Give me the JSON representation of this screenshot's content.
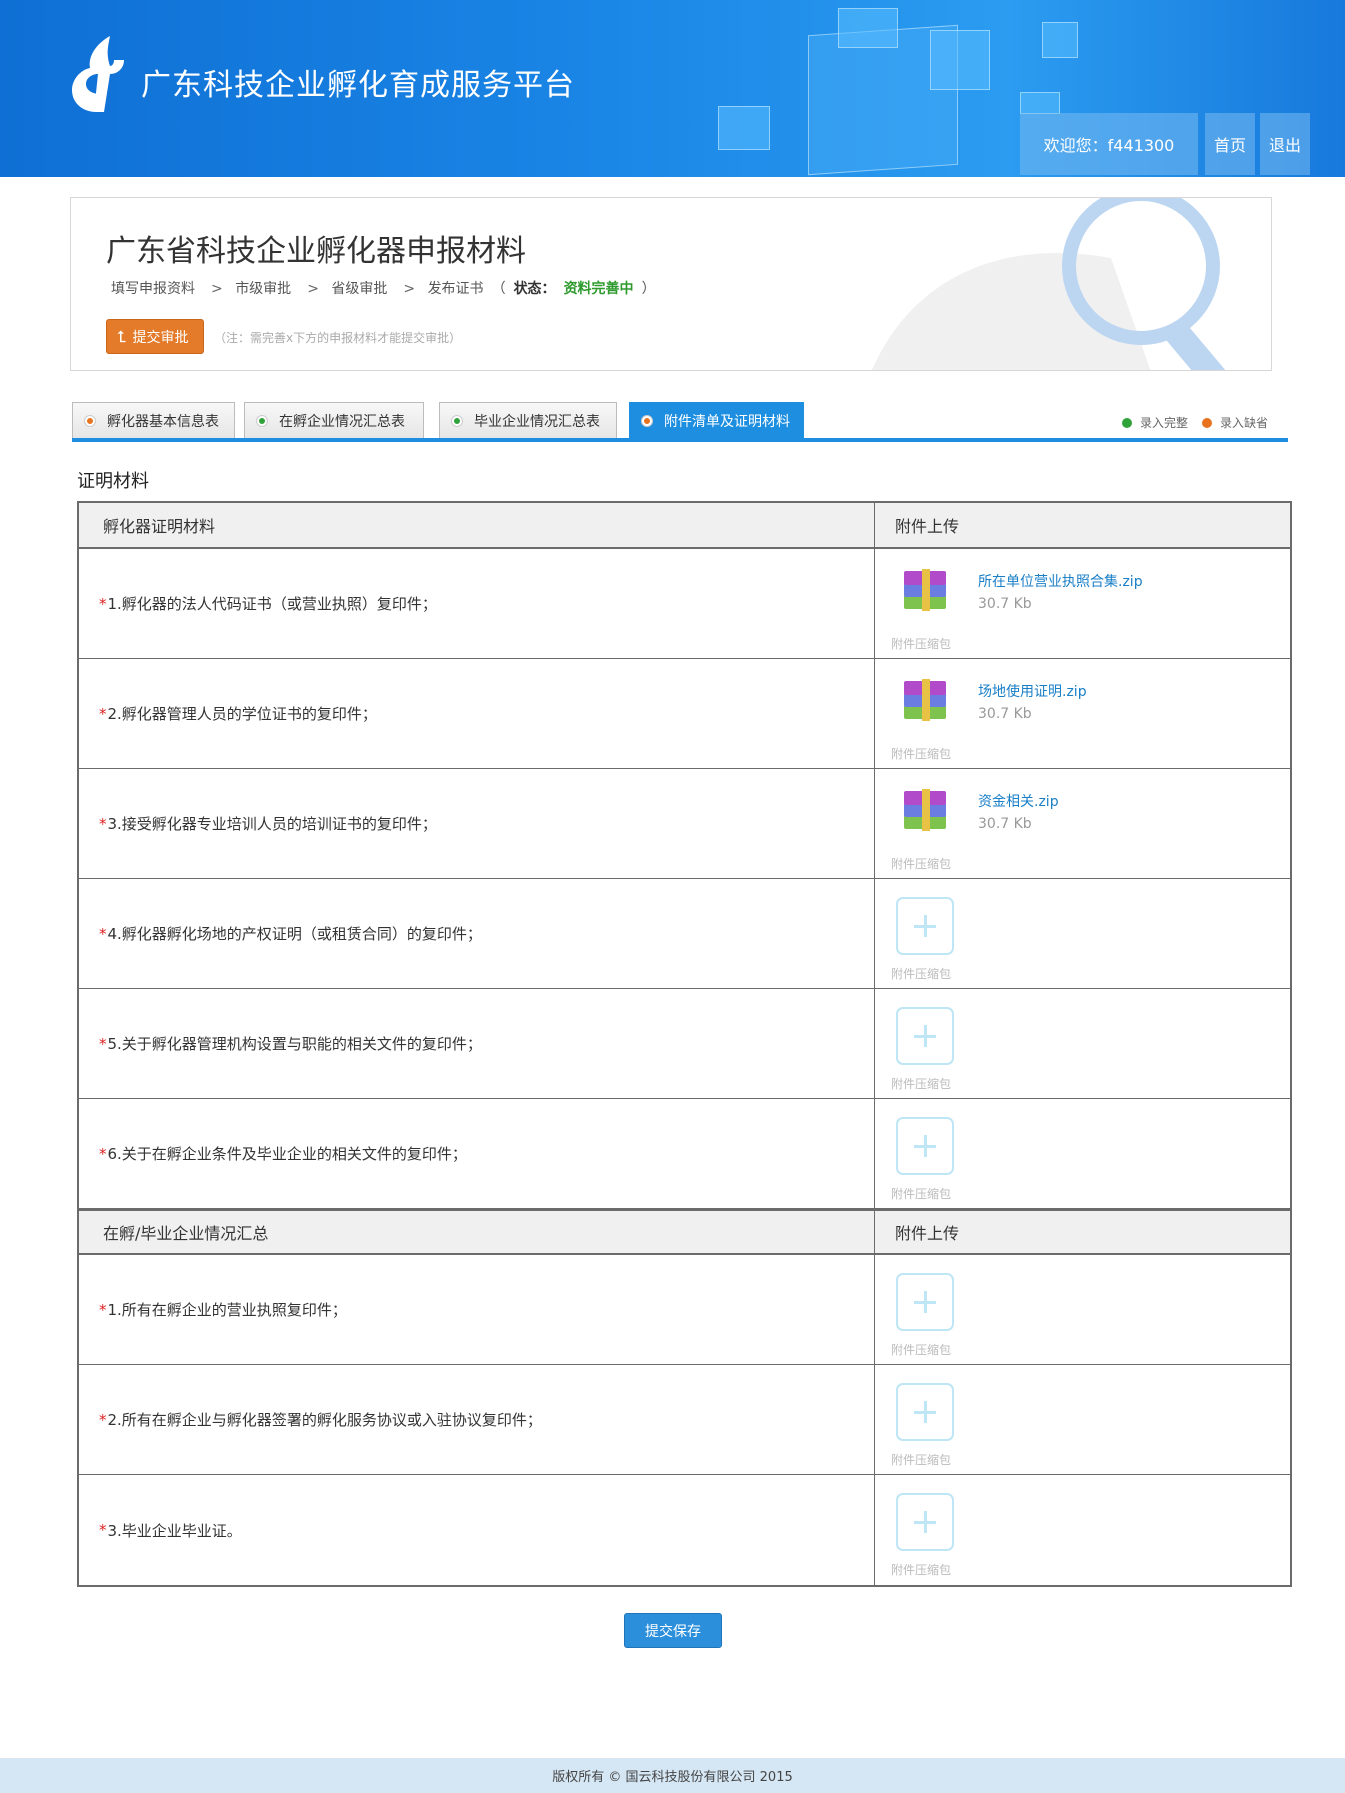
{
  "header": {
    "site_title": "广东科技企业孵化育成服务平台",
    "welcome": "欢迎您：f441300",
    "home_label": "首页",
    "logout_label": "退出"
  },
  "intro": {
    "title": "广东省科技企业孵化器申报材料",
    "steps": [
      "填写申报资料",
      "市级审批",
      "省级审批",
      "发布证书"
    ],
    "step_sep": ">",
    "state_open": "（",
    "state_label": "状态：",
    "state_value": "资料完善中",
    "state_close": "）",
    "submit_label": "提交审批",
    "note": "（注：需完善x下方的申报材料才能提交审批）"
  },
  "tabs": [
    {
      "label": "孵化器基本信息表",
      "status": "incomplete"
    },
    {
      "label": "在孵企业情况汇总表",
      "status": "complete"
    },
    {
      "label": "毕业企业情况汇总表",
      "status": "complete"
    },
    {
      "label": "附件清单及证明材料",
      "status": "incomplete",
      "active": true
    }
  ],
  "legend": {
    "complete": "录入完整",
    "incomplete": "录入缺省"
  },
  "colors": {
    "complete": "#2fa33a",
    "incomplete": "#e8731f",
    "accent": "#1e8fe0"
  },
  "section_title": "证明材料",
  "tables": [
    {
      "col1": "孵化器证明材料",
      "col2": "附件上传",
      "rows": [
        {
          "req": "*",
          "text": "1.孵化器的法人代码证书（或营业执照）复印件；",
          "file": "所在单位营业执照合集.zip",
          "size": "30.7 Kb",
          "hint": "附件压缩包"
        },
        {
          "req": "*",
          "text": "2.孵化器管理人员的学位证书的复印件；",
          "file": "场地使用证明.zip",
          "size": "30.7 Kb",
          "hint": "附件压缩包"
        },
        {
          "req": "*",
          "text": "3.接受孵化器专业培训人员的培训证书的复印件；",
          "file": "资金相关.zip",
          "size": "30.7 Kb",
          "hint": "附件压缩包"
        },
        {
          "req": "*",
          "text": "4.孵化器孵化场地的产权证明（或租赁合同）的复印件；",
          "hint": "附件压缩包"
        },
        {
          "req": "*",
          "text": "5.关于孵化器管理机构设置与职能的相关文件的复印件；",
          "hint": "附件压缩包"
        },
        {
          "req": "*",
          "text": "6.关于在孵企业条件及毕业企业的相关文件的复印件；",
          "hint": "附件压缩包"
        }
      ]
    },
    {
      "col1": "在孵/毕业企业情况汇总",
      "col2": "附件上传",
      "rows": [
        {
          "req": "*",
          "text": "1.所有在孵企业的营业执照复印件；",
          "hint": "附件压缩包"
        },
        {
          "req": "*",
          "text": "2.所有在孵企业与孵化器签署的孵化服务协议或入驻协议复印件；",
          "hint": "附件压缩包"
        },
        {
          "req": "*",
          "text": "3.毕业企业毕业证。",
          "hint": "附件压缩包"
        }
      ]
    }
  ],
  "save_label": "提交保存",
  "footer": "版权所有 © 国云科技股份有限公司 2015"
}
